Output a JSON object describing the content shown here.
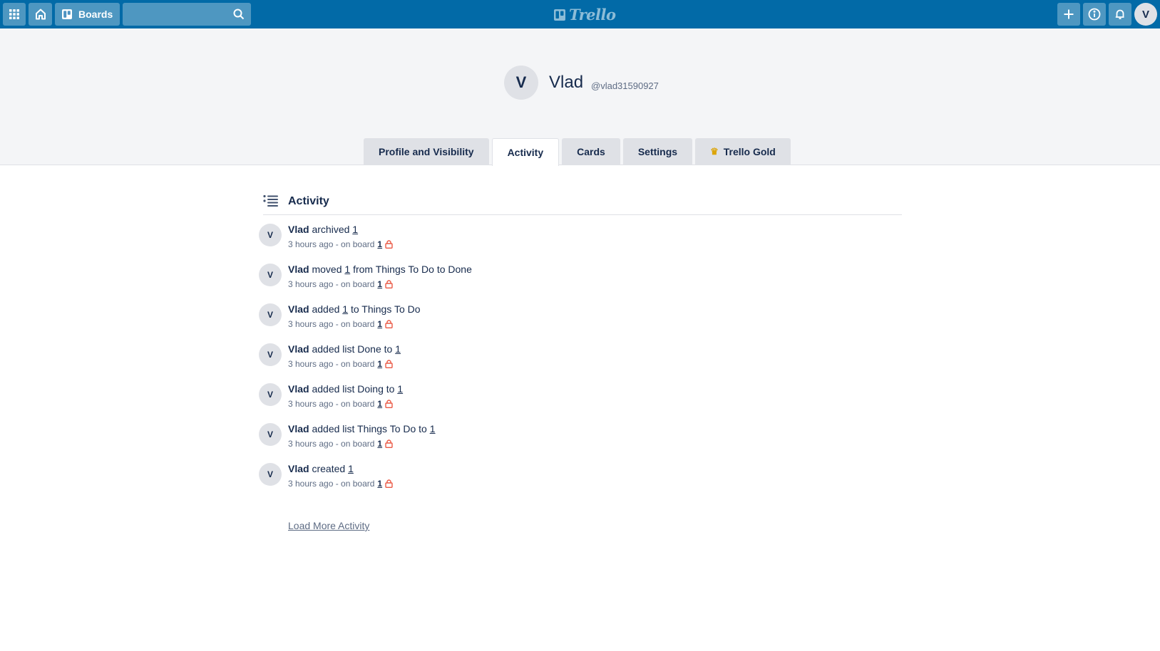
{
  "topbar": {
    "boards_label": "Boards",
    "logo_text": "Trello",
    "avatar_initial": "V",
    "icons": [
      "apps-grid-icon",
      "home-icon",
      "boards-icon",
      "search-icon",
      "plus-icon",
      "info-icon",
      "bell-icon"
    ]
  },
  "profile": {
    "initial": "V",
    "name": "Vlad",
    "username": "@vlad31590927"
  },
  "tabs": [
    {
      "label": "Profile and Visibility",
      "active": false
    },
    {
      "label": "Activity",
      "active": true
    },
    {
      "label": "Cards",
      "active": false
    },
    {
      "label": "Settings",
      "active": false
    },
    {
      "label": "Trello Gold",
      "active": false,
      "icon": "crown-icon"
    }
  ],
  "activity": {
    "title": "Activity",
    "items": [
      {
        "initial": "V",
        "actor": "Vlad",
        "before": " archived ",
        "link": "1",
        "after": "",
        "time": "3 hours ago - on board",
        "board": "1"
      },
      {
        "initial": "V",
        "actor": "Vlad",
        "before": " moved ",
        "link": "1",
        "after": " from Things To Do to Done",
        "time": "3 hours ago - on board",
        "board": "1"
      },
      {
        "initial": "V",
        "actor": "Vlad",
        "before": " added ",
        "link": "1",
        "after": " to Things To Do",
        "time": "3 hours ago - on board",
        "board": "1"
      },
      {
        "initial": "V",
        "actor": "Vlad",
        "before": " added list Done to ",
        "link": "1",
        "after": "",
        "time": "3 hours ago - on board",
        "board": "1"
      },
      {
        "initial": "V",
        "actor": "Vlad",
        "before": " added list Doing to ",
        "link": "1",
        "after": "",
        "time": "3 hours ago - on board",
        "board": "1"
      },
      {
        "initial": "V",
        "actor": "Vlad",
        "before": " added list Things To Do to ",
        "link": "1",
        "after": "",
        "time": "3 hours ago - on board",
        "board": "1"
      },
      {
        "initial": "V",
        "actor": "Vlad",
        "before": " created ",
        "link": "1",
        "after": "",
        "time": "3 hours ago - on board",
        "board": "1"
      }
    ],
    "load_more": "Load More Activity"
  },
  "colors": {
    "header_blue": "#026aa7",
    "lock_red": "#eb5a46",
    "crown_gold": "#dca50a"
  }
}
